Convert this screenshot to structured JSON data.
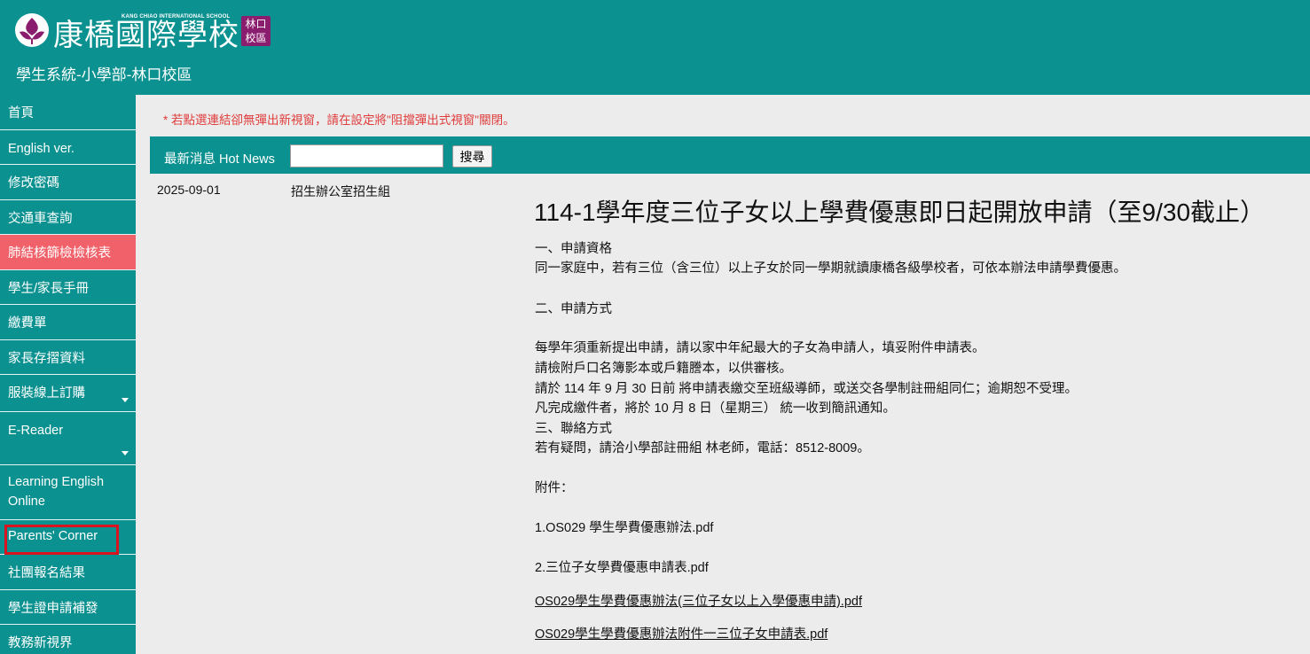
{
  "header": {
    "logo_main": "康橋國際學校",
    "logo_english": "KANG CHIAO INTERNATIONAL SCHOOL",
    "campus_badge_line1": "林口",
    "campus_badge_line2": "校區",
    "system_title": "學生系統-小學部-林口校區"
  },
  "colors": {
    "teal": "#0b9190",
    "active_item": "#f0616a",
    "notice_red": "#e03c3c",
    "highlight_border": "#d9141e",
    "campus_badge": "#8b1d6e"
  },
  "sidebar": {
    "items": [
      {
        "label": "首頁"
      },
      {
        "label": "English ver."
      },
      {
        "label": "修改密碼"
      },
      {
        "label": "交通車查詢"
      },
      {
        "label": "肺結核篩檢檢核表",
        "active": true
      },
      {
        "label": "學生/家長手冊"
      },
      {
        "label": "繳費單"
      },
      {
        "label": "家長存摺資料"
      },
      {
        "label": "服裝線上訂購",
        "has_dropdown": true
      },
      {
        "label": "E-Reader",
        "has_dropdown": true
      },
      {
        "label_line1": "Learning English",
        "label_line2": "Online"
      },
      {
        "label": "Parents' Corner",
        "highlighted": true
      },
      {
        "label": "社團報名結果"
      },
      {
        "label": "學生證申請補發"
      },
      {
        "label": "教務新視界"
      }
    ]
  },
  "notice": "* 若點選連結卻無彈出新視窗，請在設定將\"阻擋彈出式視窗\"關閉。",
  "news_bar": {
    "label": "最新消息 Hot News",
    "search_value": "",
    "search_button": "搜尋"
  },
  "news": {
    "date": "2025-09-01",
    "department": "招生辦公室招生組",
    "title": "114-1學年度三位子女以上學費優惠即日起開放申請（至9/30截止）",
    "body": [
      "一、申請資格",
      "同一家庭中，若有三位（含三位）以上子女於同一學期就讀康橋各級學校者，可依本辦法申請學費優惠。",
      "二、申請方式",
      "每學年須重新提出申請，請以家中年紀最大的子女為申請人，填妥附件申請表。",
      "請檢附戶口名簿影本或戶籍謄本，以供審核。",
      "請於 114 年 9 月 30 日前 將申請表繳交至班級導師，或送交各學制註冊組同仁；逾期恕不受理。",
      "凡完成繳件者，將於 10 月 8 日（星期三） 統一收到簡訊通知。",
      "三、聯絡方式",
      "若有疑問，請洽小學部註冊組 林老師，電話：8512-8009。",
      "附件：",
      "1.OS029 學生學費優惠辦法.pdf",
      "2.三位子女學費優惠申請表.pdf"
    ],
    "links": [
      "OS029學生學費優惠辦法(三位子女以上入學優惠申請).pdf",
      "OS029學生學費優惠辦法附件一三位子女申請表.pdf"
    ]
  }
}
